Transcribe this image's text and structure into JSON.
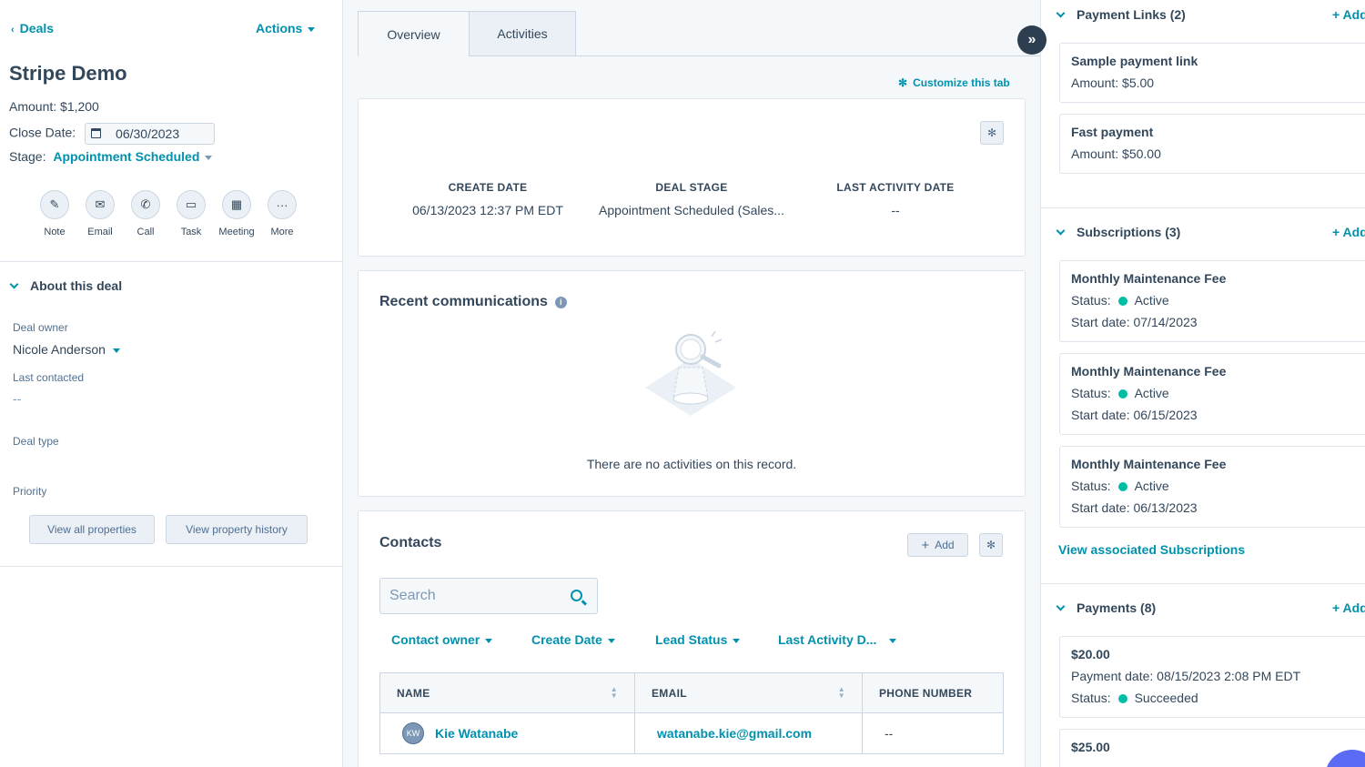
{
  "left": {
    "back_label": "Deals",
    "actions_label": "Actions",
    "deal_name": "Stripe Demo",
    "amount": "Amount: $1,200",
    "close_date_label": "Close Date:",
    "close_date_value": "06/30/2023",
    "stage_label": "Stage:",
    "stage_value": "Appointment Scheduled",
    "action_buttons": [
      {
        "label": "Note",
        "icon": "note-icon"
      },
      {
        "label": "Email",
        "icon": "email-icon"
      },
      {
        "label": "Call",
        "icon": "call-icon"
      },
      {
        "label": "Task",
        "icon": "task-icon"
      },
      {
        "label": "Meeting",
        "icon": "meeting-icon"
      },
      {
        "label": "More",
        "icon": "more-icon"
      }
    ],
    "about_title": "About this deal",
    "props": [
      {
        "label": "Deal owner",
        "value": "Nicole Anderson"
      },
      {
        "label": "Last contacted",
        "value": "--"
      },
      {
        "label": "Deal type",
        "value": ""
      },
      {
        "label": "Priority",
        "value": ""
      }
    ],
    "view_all_label": "View all properties",
    "view_history_label": "View property history"
  },
  "middle": {
    "tabs": [
      {
        "label": "Overview"
      },
      {
        "label": "Activities"
      }
    ],
    "customize_label": "Customize this tab",
    "highlights": [
      {
        "header": "CREATE DATE",
        "value": "06/13/2023 12:37 PM EDT"
      },
      {
        "header": "DEAL STAGE",
        "value": "Appointment Scheduled (Sales..."
      },
      {
        "header": "LAST ACTIVITY DATE",
        "value": "--"
      }
    ],
    "recent_title": "Recent communications",
    "empty_text": "There are no activities on this record.",
    "contacts_title": "Contacts",
    "add_label": "Add",
    "search_placeholder": "Search",
    "filters": [
      "Contact owner",
      "Create Date",
      "Lead Status",
      "Last Activity D..."
    ],
    "table": {
      "headers": [
        "NAME",
        "EMAIL",
        "PHONE NUMBER"
      ],
      "rows": [
        {
          "initials": "KW",
          "name": "Kie Watanabe",
          "email": "watanabe.kie@gmail.com",
          "phone": "--"
        }
      ]
    }
  },
  "right": {
    "payment_links_title": "Payment Links (2)",
    "add_label": "+ Add",
    "payment_links": [
      {
        "title": "Sample payment link",
        "amount_label": "Amount:",
        "amount": "$5.00"
      },
      {
        "title": "Fast payment",
        "amount_label": "Amount:",
        "amount": "$50.00"
      }
    ],
    "subscriptions_title": "Subscriptions (3)",
    "subscriptions": [
      {
        "title": "Monthly Maintenance Fee",
        "status_label": "Status:",
        "status": "Active",
        "start_label": "Start date:",
        "start": "07/14/2023"
      },
      {
        "title": "Monthly Maintenance Fee",
        "status_label": "Status:",
        "status": "Active",
        "start_label": "Start date:",
        "start": "06/15/2023"
      },
      {
        "title": "Monthly Maintenance Fee",
        "status_label": "Status:",
        "status": "Active",
        "start_label": "Start date:",
        "start": "06/13/2023"
      }
    ],
    "view_subs_label": "View associated Subscriptions",
    "payments_title": "Payments (8)",
    "payments": [
      {
        "amount": "$20.00",
        "date_label": "Payment date:",
        "date": "08/15/2023 2:08 PM EDT",
        "status_label": "Status:",
        "status": "Succeeded"
      },
      {
        "amount": "$25.00"
      }
    ]
  },
  "colors": {
    "accent": "#0091ae",
    "text": "#33475b",
    "success": "#00bda5"
  }
}
